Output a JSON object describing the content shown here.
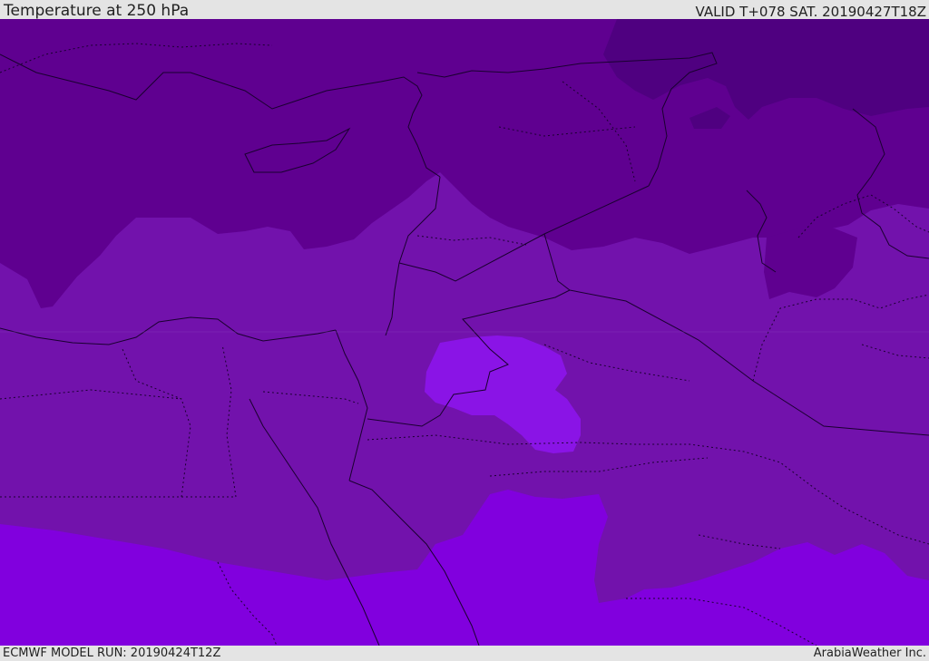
{
  "header": {
    "title": "Temperature at 250 hPa",
    "valid_time": "VALID T+078 SAT. 20190427T18Z"
  },
  "footer": {
    "model_run": "ECMWF MODEL RUN: 20190424T12Z",
    "credit": "ArabiaWeather Inc."
  },
  "map": {
    "variable": "temperature",
    "level": "250 hPa",
    "colors": {
      "coldest": "#4f0080",
      "cold": "#5f0090",
      "mid": "#7212ac",
      "warm": "#8100de",
      "warm_patch": "#8a14e6"
    }
  }
}
